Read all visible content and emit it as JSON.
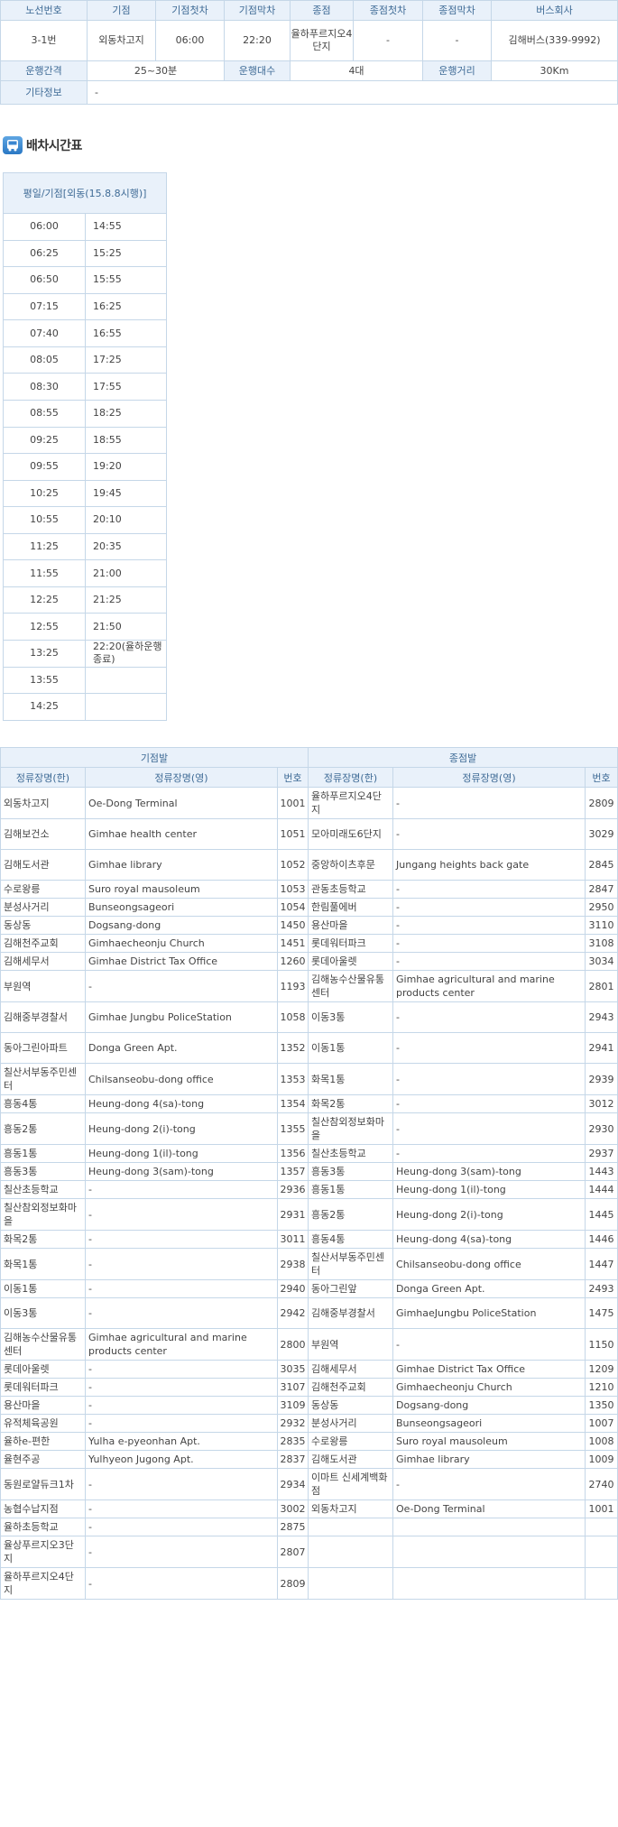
{
  "route_info": {
    "headers": [
      "노선번호",
      "기점",
      "기점첫차",
      "기점막차",
      "종점",
      "종점첫차",
      "종점막차",
      "버스회사"
    ],
    "values": [
      "3-1번",
      "외동차고지",
      "06:00",
      "22:20",
      "율하푸르지오4단지",
      "-",
      "-",
      "김해버스(339-9992)"
    ],
    "interval_label": "운행간격",
    "interval_value": "25~30분",
    "count_label": "운행대수",
    "count_value": "4대",
    "distance_label": "운행거리",
    "distance_value": "30Km",
    "etc_label": "기타정보",
    "etc_value": "-"
  },
  "schedule": {
    "title": "배차시간표",
    "icon": "bus-icon",
    "header": "평일/기점[외동(15.8.8시행)]",
    "col1": [
      "06:00",
      "06:25",
      "06:50",
      "07:15",
      "07:40",
      "08:05",
      "08:30",
      "08:55",
      "09:25",
      "09:55",
      "10:25",
      "10:55",
      "11:25",
      "11:55",
      "12:25",
      "12:55",
      "13:25",
      "13:55",
      "14:25"
    ],
    "col2": [
      "14:55",
      "15:25",
      "15:55",
      "16:25",
      "16:55",
      "17:25",
      "17:55",
      "18:25",
      "18:55",
      "19:20",
      "19:45",
      "20:10",
      "20:35",
      "21:00",
      "21:25",
      "21:50",
      "22:20(율하운행종료)",
      "",
      ""
    ]
  },
  "stops": {
    "group_start": "기점발",
    "group_end": "종점발",
    "col_name_ko": "정류장명(한)",
    "col_name_en": "정류장명(영)",
    "col_no": "번호",
    "rows": [
      [
        "외동차고지",
        "Oe-Dong Terminal",
        "1001",
        "율하푸르지오4단지",
        "-",
        "2809"
      ],
      [
        "김해보건소",
        "Gimhae health center",
        "1051",
        "모아미래도6단지",
        "-",
        "3029"
      ],
      [
        "김해도서관",
        "Gimhae library",
        "1052",
        "중앙하이츠후문",
        "Jungang heights back gate",
        "2845"
      ],
      [
        "수로왕릉",
        "Suro royal mausoleum",
        "1053",
        "관동초등학교",
        "-",
        "2847"
      ],
      [
        "분성사거리",
        "Bunseongsageori",
        "1054",
        "한림풀에버",
        "-",
        "2950"
      ],
      [
        "동상동",
        "Dogsang-dong",
        "1450",
        "용산마을",
        "-",
        "3110"
      ],
      [
        "김해천주교회",
        "Gimhaecheonju Church",
        "1451",
        "롯데워터파크",
        "-",
        "3108"
      ],
      [
        "김해세무서",
        "Gimhae District Tax Office",
        "1260",
        "롯데아울렛",
        "-",
        "3034"
      ],
      [
        "부원역",
        "-",
        "1193",
        "김해농수산물유통센터",
        "Gimhae agricultural and marine products center",
        "2801"
      ],
      [
        "김해중부경찰서",
        "Gimhae Jungbu PoliceStation",
        "1058",
        "이동3통",
        "-",
        "2943"
      ],
      [
        "동아그린아파트",
        "Donga Green Apt.",
        "1352",
        "이동1통",
        "-",
        "2941"
      ],
      [
        "칠산서부동주민센터",
        "Chilsanseobu-dong office",
        "1353",
        "화목1통",
        "-",
        "2939"
      ],
      [
        "흥동4통",
        "Heung-dong 4(sa)-tong",
        "1354",
        "화목2통",
        "-",
        "3012"
      ],
      [
        "흥동2통",
        "Heung-dong 2(i)-tong",
        "1355",
        "칠산참외정보화마을",
        "-",
        "2930"
      ],
      [
        "흥동1통",
        "Heung-dong 1(il)-tong",
        "1356",
        "칠산초등학교",
        "-",
        "2937"
      ],
      [
        "흥동3통",
        "Heung-dong 3(sam)-tong",
        "1357",
        "흥동3통",
        "Heung-dong 3(sam)-tong",
        "1443"
      ],
      [
        "칠산초등학교",
        "-",
        "2936",
        "흥동1통",
        "Heung-dong 1(il)-tong",
        "1444"
      ],
      [
        "칠산참외정보화마을",
        "-",
        "2931",
        "흥동2통",
        "Heung-dong 2(i)-tong",
        "1445"
      ],
      [
        "화목2통",
        "-",
        "3011",
        "흥동4통",
        "Heung-dong 4(sa)-tong",
        "1446"
      ],
      [
        "화목1통",
        "-",
        "2938",
        "칠산서부동주민센터",
        "Chilsanseobu-dong office",
        "1447"
      ],
      [
        "이동1통",
        "-",
        "2940",
        "동아그린앞",
        "Donga Green Apt.",
        "2493"
      ],
      [
        "이동3통",
        "-",
        "2942",
        "김해중부경찰서",
        "GimhaeJungbu PoliceStation",
        "1475"
      ],
      [
        "김해농수산물유통센터",
        "Gimhae agricultural and marine products center",
        "2800",
        "부원역",
        "-",
        "1150"
      ],
      [
        "롯데아울렛",
        "-",
        "3035",
        "김해세무서",
        "Gimhae District Tax Office",
        "1209"
      ],
      [
        "롯데워터파크",
        "-",
        "3107",
        "김해천주교회",
        "Gimhaecheonju Church",
        "1210"
      ],
      [
        "용산마을",
        "-",
        "3109",
        "동상동",
        "Dogsang-dong",
        "1350"
      ],
      [
        "유적체육공원",
        "-",
        "2932",
        "분성사거리",
        "Bunseongsageori",
        "1007"
      ],
      [
        "율하e-편한",
        "Yulha e-pyeonhan Apt.",
        "2835",
        "수로왕릉",
        "Suro royal mausoleum",
        "1008"
      ],
      [
        "율현주공",
        "Yulhyeon Jugong Apt.",
        "2837",
        "김해도서관",
        "Gimhae library",
        "1009"
      ],
      [
        "동원로얄듀크1차",
        "-",
        "2934",
        "이마트 신세계백화점",
        "-",
        "2740"
      ],
      [
        "농협수납지점",
        "-",
        "3002",
        "외동차고지",
        "Oe-Dong Terminal",
        "1001"
      ],
      [
        "율하초등학교",
        "-",
        "2875",
        "",
        "",
        ""
      ],
      [
        "율상푸르지오3단지",
        "-",
        "2807",
        "",
        "",
        ""
      ],
      [
        "율하푸르지오4단지",
        "-",
        "2809",
        "",
        "",
        ""
      ]
    ]
  }
}
